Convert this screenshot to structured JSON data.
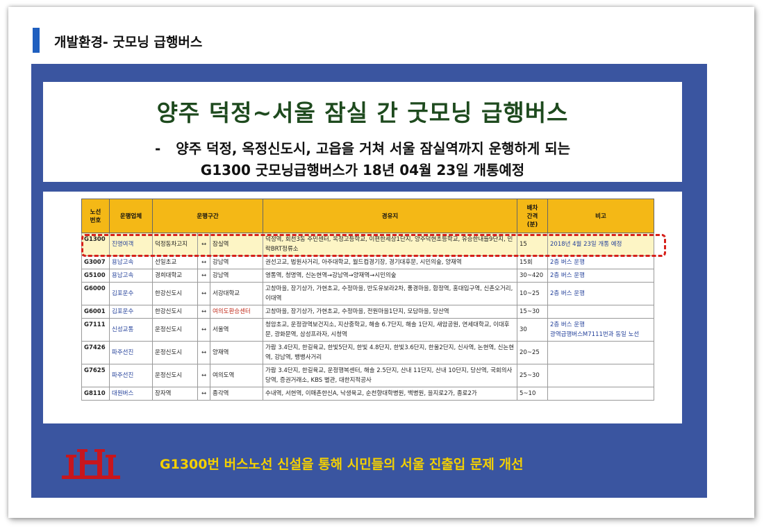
{
  "header": {
    "title": "개발환경- 굿모닝 급행버스"
  },
  "headline": {
    "title": "양주 덕정~서울 잠실 간 굿모닝 급행버스",
    "dash": "-",
    "line1": "양주 덕정, 옥정신도시, 고읍을 거쳐 서울 잠실역까지 운행하게 되는",
    "line2": "G1300 굿모닝급행버스가 18년 04월 23일 개통예정"
  },
  "table": {
    "headers": {
      "route": "노선\n번호",
      "operator": "운행업체",
      "section": "운행구간",
      "via": "경유지",
      "interval": "배차\n간격\n(분)",
      "note": "비고"
    },
    "rows": [
      {
        "route": "G1300",
        "operator": "진명여객",
        "from": "덕정동차고지",
        "arrow": "↔",
        "to": "잠실역",
        "via": "덕정역, 회천3동 주민센터, 옥정고등학교, 이편한세상1단지, 양주덕현초등학교, 유승한내들9단지, 민락BRT정류소",
        "interval": "15",
        "note": "2018년 4월 23일 개통 예정"
      },
      {
        "route": "G3007",
        "operator": "용남고속",
        "from": "선일초교",
        "arrow": "↔",
        "to": "강남역",
        "via": "권선고교, 법원사거리, 아주대학교, 월드컵경기장, 경기대후문, 시민의숲, 양재역",
        "interval": "15회",
        "note": "2층 버스 운행"
      },
      {
        "route": "G5100",
        "operator": "용남고속",
        "from": "경희대학교",
        "arrow": "↔",
        "to": "강남역",
        "via": "영통역, 청명역, 신논현역→강남역→양재역→시민의숲",
        "interval": "30~420",
        "note": "2층 버스 운행"
      },
      {
        "route": "G6000",
        "operator": "김포운수",
        "from": "한강신도시",
        "arrow": "↔",
        "to": "서강대학교",
        "via": "고창마을, 장기상가, 가현초교, 수정마을, 반도유보라2차, 풍경마을, 합정역, 홍대입구역, 신촌오거리, 이대역",
        "interval": "10~25",
        "note": "2층 버스 운행"
      },
      {
        "route": "G6001",
        "operator": "김포운수",
        "from": "한강신도시",
        "arrow": "↔",
        "to": "여의도환승센터",
        "via": "고창마을, 장기상가, 가현초교, 수정마을, 전원마을1단지, 모담마을, 당산역",
        "interval": "15~30",
        "note": ""
      },
      {
        "route": "G7111",
        "operator": "신성교통",
        "from": "운정신도시",
        "arrow": "↔",
        "to": "서울역",
        "via": "청암초교, 운정광역보건지소, 지산중학교, 해솔 6.7단지, 해솔 1단지, 새암공원, 연세대학교, 이대후문, 광화문역, 삼성프라자, 시청역",
        "interval": "30",
        "note": "2층 버스 운행\n광역급행버스M7111번과 동일 노선"
      },
      {
        "route": "G7426",
        "operator": "파주선진",
        "from": "운정신도시",
        "arrow": "↔",
        "to": "양재역",
        "via": "가람 3.4단지, 한길육교, 한빛5단지, 한빛 4.8단지, 한빛3.6단지, 한울2단지, 신사역, 논현역, 신논현역, 강남역, 뱅뱅사거리",
        "interval": "20~25",
        "note": ""
      },
      {
        "route": "G7625",
        "operator": "파주선진",
        "from": "운정신도시",
        "arrow": "↔",
        "to": "여의도역",
        "via": "가람 3.4단지, 한길육교, 운정행복센터, 해솔 2.5단지, 산내 11단지, 산내 10단지, 당산역, 국회의사당역, 증권거래소, KBS 별관, 대한지적공사",
        "interval": "25~30",
        "note": ""
      },
      {
        "route": "G8110",
        "operator": "대원버스",
        "from": "장자역",
        "arrow": "↔",
        "to": "종각역",
        "via": "수내역, 서현역, 이매촌한신A, 낙생육교, 순천향대학병원, 백병원, 을지로2가, 종로2가",
        "interval": "5~10",
        "note": ""
      }
    ]
  },
  "footer": {
    "message": "G1300번 버스노선 신설을 통해 시민들의 서울 진출입 문제 개선"
  },
  "colors": {
    "panel": "#3a55a0",
    "header_bar": "#1f5fbf",
    "table_header": "#f4b816",
    "highlight_row": "#fdf5c5",
    "highlight_outline": "#d6201a",
    "title_text": "#1e4a1e",
    "footer_text": "#f4d000",
    "logo": "#c8161d"
  }
}
